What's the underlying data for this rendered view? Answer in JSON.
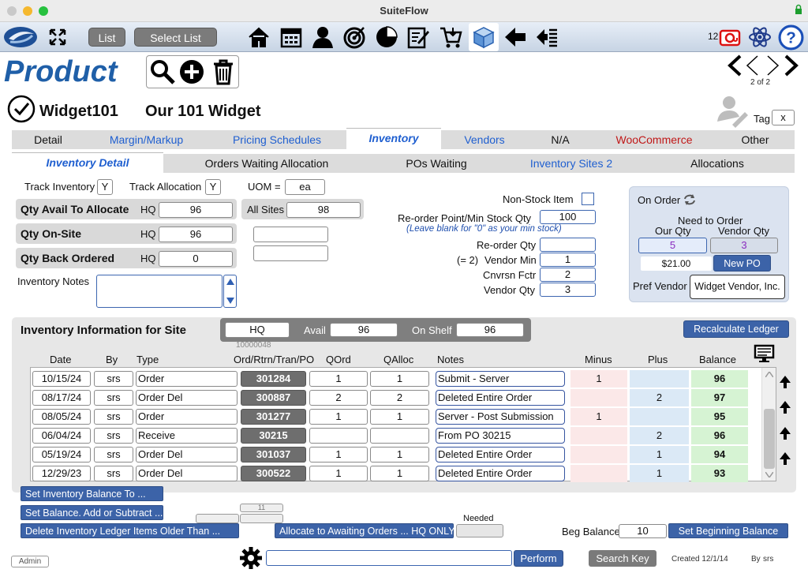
{
  "window": {
    "title": "SuiteFlow"
  },
  "toolbar": {
    "list_label": "List",
    "select_list_label": "Select List",
    "mail_count": "12",
    "icons": [
      "logo-icon",
      "expand-icon",
      "home-icon",
      "calendar-icon",
      "person-icon",
      "target-icon",
      "pie-chart-icon",
      "edit-document-icon",
      "cart-icon",
      "box-icon",
      "back-arrow-icon",
      "list-arrow-icon",
      "mail-icon",
      "atom-icon",
      "help-icon"
    ]
  },
  "product": {
    "title": "Product",
    "id": "Widget101",
    "name": "Our 101 Widget",
    "tag_label": "Tag",
    "tag_value": "x",
    "pager": "2 of 2"
  },
  "tabs": [
    {
      "label": "Detail"
    },
    {
      "label": "Margin/Markup"
    },
    {
      "label": "Pricing Schedules"
    },
    {
      "label": "Inventory"
    },
    {
      "label": "Vendors"
    },
    {
      "label": "N/A"
    },
    {
      "label": "WooCommerce"
    },
    {
      "label": "Other"
    }
  ],
  "subtabs": [
    {
      "label": "Inventory Detail"
    },
    {
      "label": "Orders Waiting Allocation"
    },
    {
      "label": "POs Waiting"
    },
    {
      "label": "Inventory Sites  2"
    },
    {
      "label": "Allocations"
    }
  ],
  "settings": {
    "track_inventory_label": "Track Inventory",
    "track_inventory": "Y",
    "track_allocation_label": "Track Allocation",
    "track_allocation": "Y",
    "uom_label": "UOM =",
    "uom": "ea"
  },
  "qty": {
    "avail_label": "Qty Avail To Allocate",
    "avail_hq_label": "HQ",
    "avail_hq": "96",
    "all_sites_label": "All Sites",
    "all_sites": "98",
    "onsite_label": "Qty On-Site",
    "onsite_hq_label": "HQ",
    "onsite_hq": "96",
    "backordered_label": "Qty Back Ordered",
    "backordered_hq_label": "HQ",
    "backordered_hq": "0",
    "notes_label": "Inventory Notes",
    "notes": ""
  },
  "reorder": {
    "nonstock_label": "Non-Stock Item",
    "reorder_point_label": "Re-order Point/Min Stock Qty",
    "reorder_point": "100",
    "reorder_hint": "(Leave blank for \"0\" as your min stock)",
    "reorder_qty_label": "Re-order Qty",
    "reorder_qty": "",
    "vendor_min_prefix": "(= 2)",
    "vendor_min_label": "Vendor Min",
    "vendor_min": "1",
    "cnvrsn_label": "Cnvrsn Fctr",
    "cnvrsn": "2",
    "vendor_qty_label": "Vendor Qty",
    "vendor_qty": "3"
  },
  "on_order": {
    "title": "On Order",
    "need_label": "Need to Order",
    "our_qty_label": "Our Qty",
    "our_qty": "5",
    "vendor_qty_label": "Vendor Qty",
    "vendor_qty": "3",
    "cost": "$21.00",
    "new_po_label": "New PO",
    "pref_vendor_label": "Pref Vendor",
    "pref_vendor": "Widget Vendor, Inc."
  },
  "site": {
    "heading": "Inventory Information for Site",
    "site_value": "HQ",
    "site_code": "10000048",
    "avail_label": "Avail",
    "avail": "96",
    "onshelf_label": "On Shelf",
    "onshelf": "96",
    "recalc_label": "Recalculate Ledger"
  },
  "ledger": {
    "headers": {
      "date": "Date",
      "by": "By",
      "type": "Type",
      "ord": "Ord/Rtrn/Tran/PO",
      "qord": "QOrd",
      "qalloc": "QAlloc",
      "notes": "Notes",
      "minus": "Minus",
      "plus": "Plus",
      "balance": "Balance"
    },
    "rows": [
      {
        "date": "10/15/24",
        "by": "srs",
        "type": "Order",
        "ord": "301284",
        "qord": "1",
        "qalloc": "1",
        "notes": "Submit - Server",
        "minus": "1",
        "plus": "",
        "balance": "96"
      },
      {
        "date": "08/17/24",
        "by": "srs",
        "type": "Order Del",
        "ord": "300887",
        "qord": "2",
        "qalloc": "2",
        "notes": "Deleted Entire Order",
        "minus": "",
        "plus": "2",
        "balance": "97"
      },
      {
        "date": "08/05/24",
        "by": "srs",
        "type": "Order",
        "ord": "301277",
        "qord": "1",
        "qalloc": "1",
        "notes": "Server - Post Submission",
        "minus": "1",
        "plus": "",
        "balance": "95"
      },
      {
        "date": "06/04/24",
        "by": "srs",
        "type": "Receive",
        "ord": "30215",
        "qord": "",
        "qalloc": "",
        "notes": "From PO 30215",
        "minus": "",
        "plus": "2",
        "balance": "96"
      },
      {
        "date": "05/19/24",
        "by": "srs",
        "type": "Order Del",
        "ord": "301037",
        "qord": "1",
        "qalloc": "1",
        "notes": "Deleted Entire Order",
        "minus": "",
        "plus": "1",
        "balance": "94"
      },
      {
        "date": "12/29/23",
        "by": "srs",
        "type": "Order Del",
        "ord": "300522",
        "qord": "1",
        "qalloc": "1",
        "notes": "Deleted Entire Order",
        "minus": "",
        "plus": "1",
        "balance": "93"
      }
    ]
  },
  "actions": {
    "set_balance_to": "Set Inventory Balance To ...",
    "set_balance_add": "Set Balance. Add or Subtract ...",
    "delete_older": "Delete Inventory Ledger Items Older Than ...",
    "allocate": "Allocate to Awaiting Orders ... HQ ONLY",
    "small_count": "11",
    "needed_label": "Needed",
    "beg_balance_label": "Beg Balance",
    "beg_balance": "10",
    "set_beginning": "Set Beginning Balance"
  },
  "footer": {
    "admin_label": "Admin",
    "perform_label": "Perform",
    "search_key_label": "Search Key",
    "created_label": "Created 12/1/14",
    "by_label": "By",
    "by_value": "srs"
  }
}
